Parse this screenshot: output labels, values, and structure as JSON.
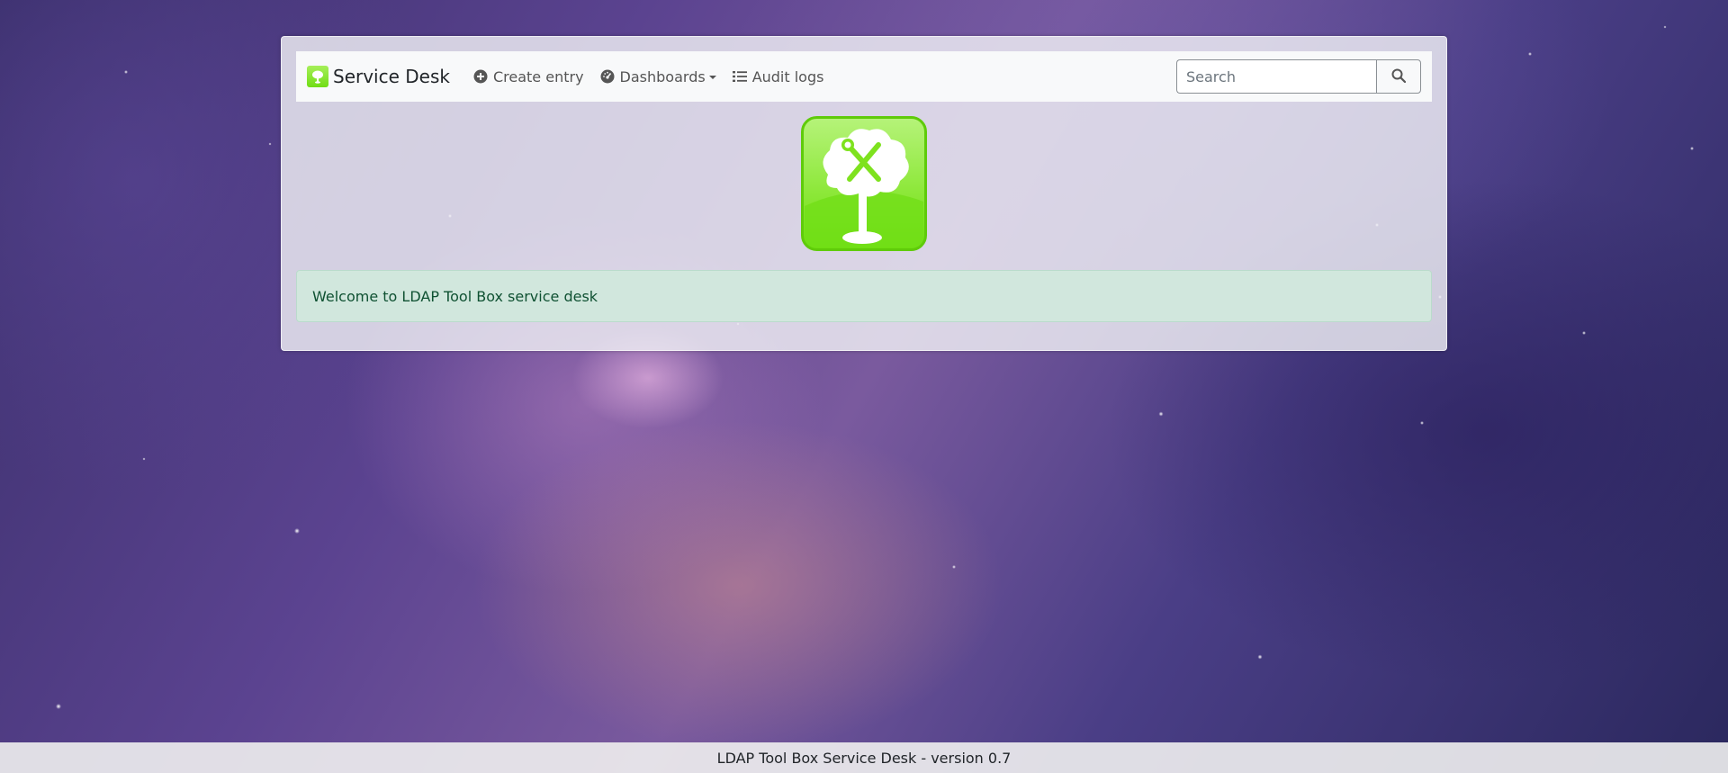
{
  "navbar": {
    "brand": "Service Desk",
    "items": [
      {
        "label": "Create entry",
        "icon": "plus-circle-icon"
      },
      {
        "label": "Dashboards",
        "icon": "dashboard-gauge-icon",
        "dropdown": true
      },
      {
        "label": "Audit logs",
        "icon": "list-icon"
      }
    ],
    "search": {
      "placeholder": "Search",
      "value": ""
    }
  },
  "logo": {
    "icon": "ldap-toolbox-tree-logo",
    "color": "#7ee21e"
  },
  "alert": {
    "message": "Welcome to LDAP Tool Box service desk",
    "color": "#d1e7dd"
  },
  "footer": {
    "text": "LDAP Tool Box Service Desk - version 0.7"
  }
}
